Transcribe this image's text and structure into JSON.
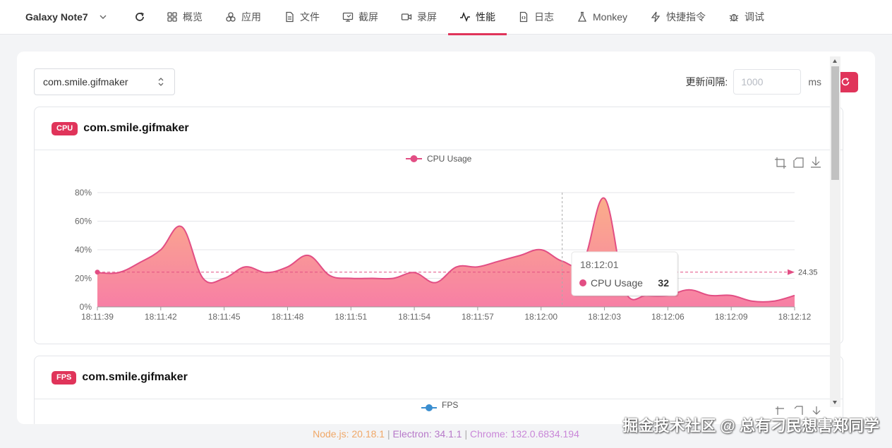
{
  "nav": {
    "device_name": "Galaxy Note7",
    "tabs": [
      {
        "label": "概览",
        "icon": "grid-icon"
      },
      {
        "label": "应用",
        "icon": "apps-icon"
      },
      {
        "label": "文件",
        "icon": "file-icon"
      },
      {
        "label": "截屏",
        "icon": "screenshot-icon"
      },
      {
        "label": "录屏",
        "icon": "video-icon"
      },
      {
        "label": "性能",
        "icon": "activity-icon",
        "active": true
      },
      {
        "label": "日志",
        "icon": "log-icon"
      },
      {
        "label": "Monkey",
        "icon": "flask-icon"
      },
      {
        "label": "快捷指令",
        "icon": "bolt-icon"
      },
      {
        "label": "调试",
        "icon": "bug-icon"
      }
    ]
  },
  "toolbar": {
    "package_value": "com.smile.gifmaker",
    "interval_label": "更新间隔:",
    "interval_placeholder": "1000",
    "interval_unit": "ms"
  },
  "cpu_card": {
    "badge": "CPU",
    "title": "com.smile.gifmaker"
  },
  "fps_card": {
    "badge": "FPS",
    "title": "com.smile.gifmaker",
    "legend": "FPS"
  },
  "tooltip": {
    "time": "18:12:01",
    "series": "CPU Usage",
    "value": "32"
  },
  "footer": {
    "node": "Node.js: 20.18.1",
    "electron": "Electron: 34.1.1",
    "chrome": "Chrome: 132.0.6834.194"
  },
  "watermark": "掘金技术社区 @ 总有刁民想害郑同学",
  "colors": {
    "accent": "#e0345a",
    "line": "#e24e84",
    "area_top": "#fbae8a",
    "area_bottom": "#f77fa5",
    "node": "#f0a868",
    "electron": "#b779c9",
    "chrome": "#c987d8"
  },
  "chart_data": {
    "type": "area",
    "legend": [
      "CPU Usage"
    ],
    "x": [
      "18:11:39",
      "18:11:40",
      "18:11:41",
      "18:11:42",
      "18:11:43",
      "18:11:44",
      "18:11:45",
      "18:11:46",
      "18:11:47",
      "18:11:48",
      "18:11:49",
      "18:11:50",
      "18:11:51",
      "18:11:52",
      "18:11:53",
      "18:11:54",
      "18:11:55",
      "18:11:56",
      "18:11:57",
      "18:11:58",
      "18:11:59",
      "18:12:00",
      "18:12:01",
      "18:12:02",
      "18:12:03",
      "18:12:04",
      "18:12:05",
      "18:12:06",
      "18:12:07",
      "18:12:08",
      "18:12:09",
      "18:12:10",
      "18:12:11",
      "18:12:12"
    ],
    "series": [
      {
        "name": "CPU Usage",
        "values": [
          24,
          24,
          31,
          40,
          56,
          20,
          20,
          28,
          24,
          28,
          36,
          22,
          20,
          20,
          20,
          24,
          17,
          28,
          28,
          32,
          36,
          40,
          32,
          32,
          76,
          10,
          8,
          8,
          12,
          8,
          8,
          4,
          4,
          8
        ]
      }
    ],
    "x_ticks": [
      "18:11:39",
      "18:11:42",
      "18:11:45",
      "18:11:48",
      "18:11:51",
      "18:11:54",
      "18:11:57",
      "18:12:00",
      "18:12:03",
      "18:12:06",
      "18:12:09",
      "18:12:12"
    ],
    "y_ticks": [
      "0%",
      "20%",
      "40%",
      "60%",
      "80%"
    ],
    "ylim": [
      0,
      80
    ],
    "mark_line": {
      "type": "average",
      "value": 24.35,
      "label": "24.35"
    },
    "tooltip_index": 22,
    "grid": true,
    "legend_position": "top-center"
  }
}
